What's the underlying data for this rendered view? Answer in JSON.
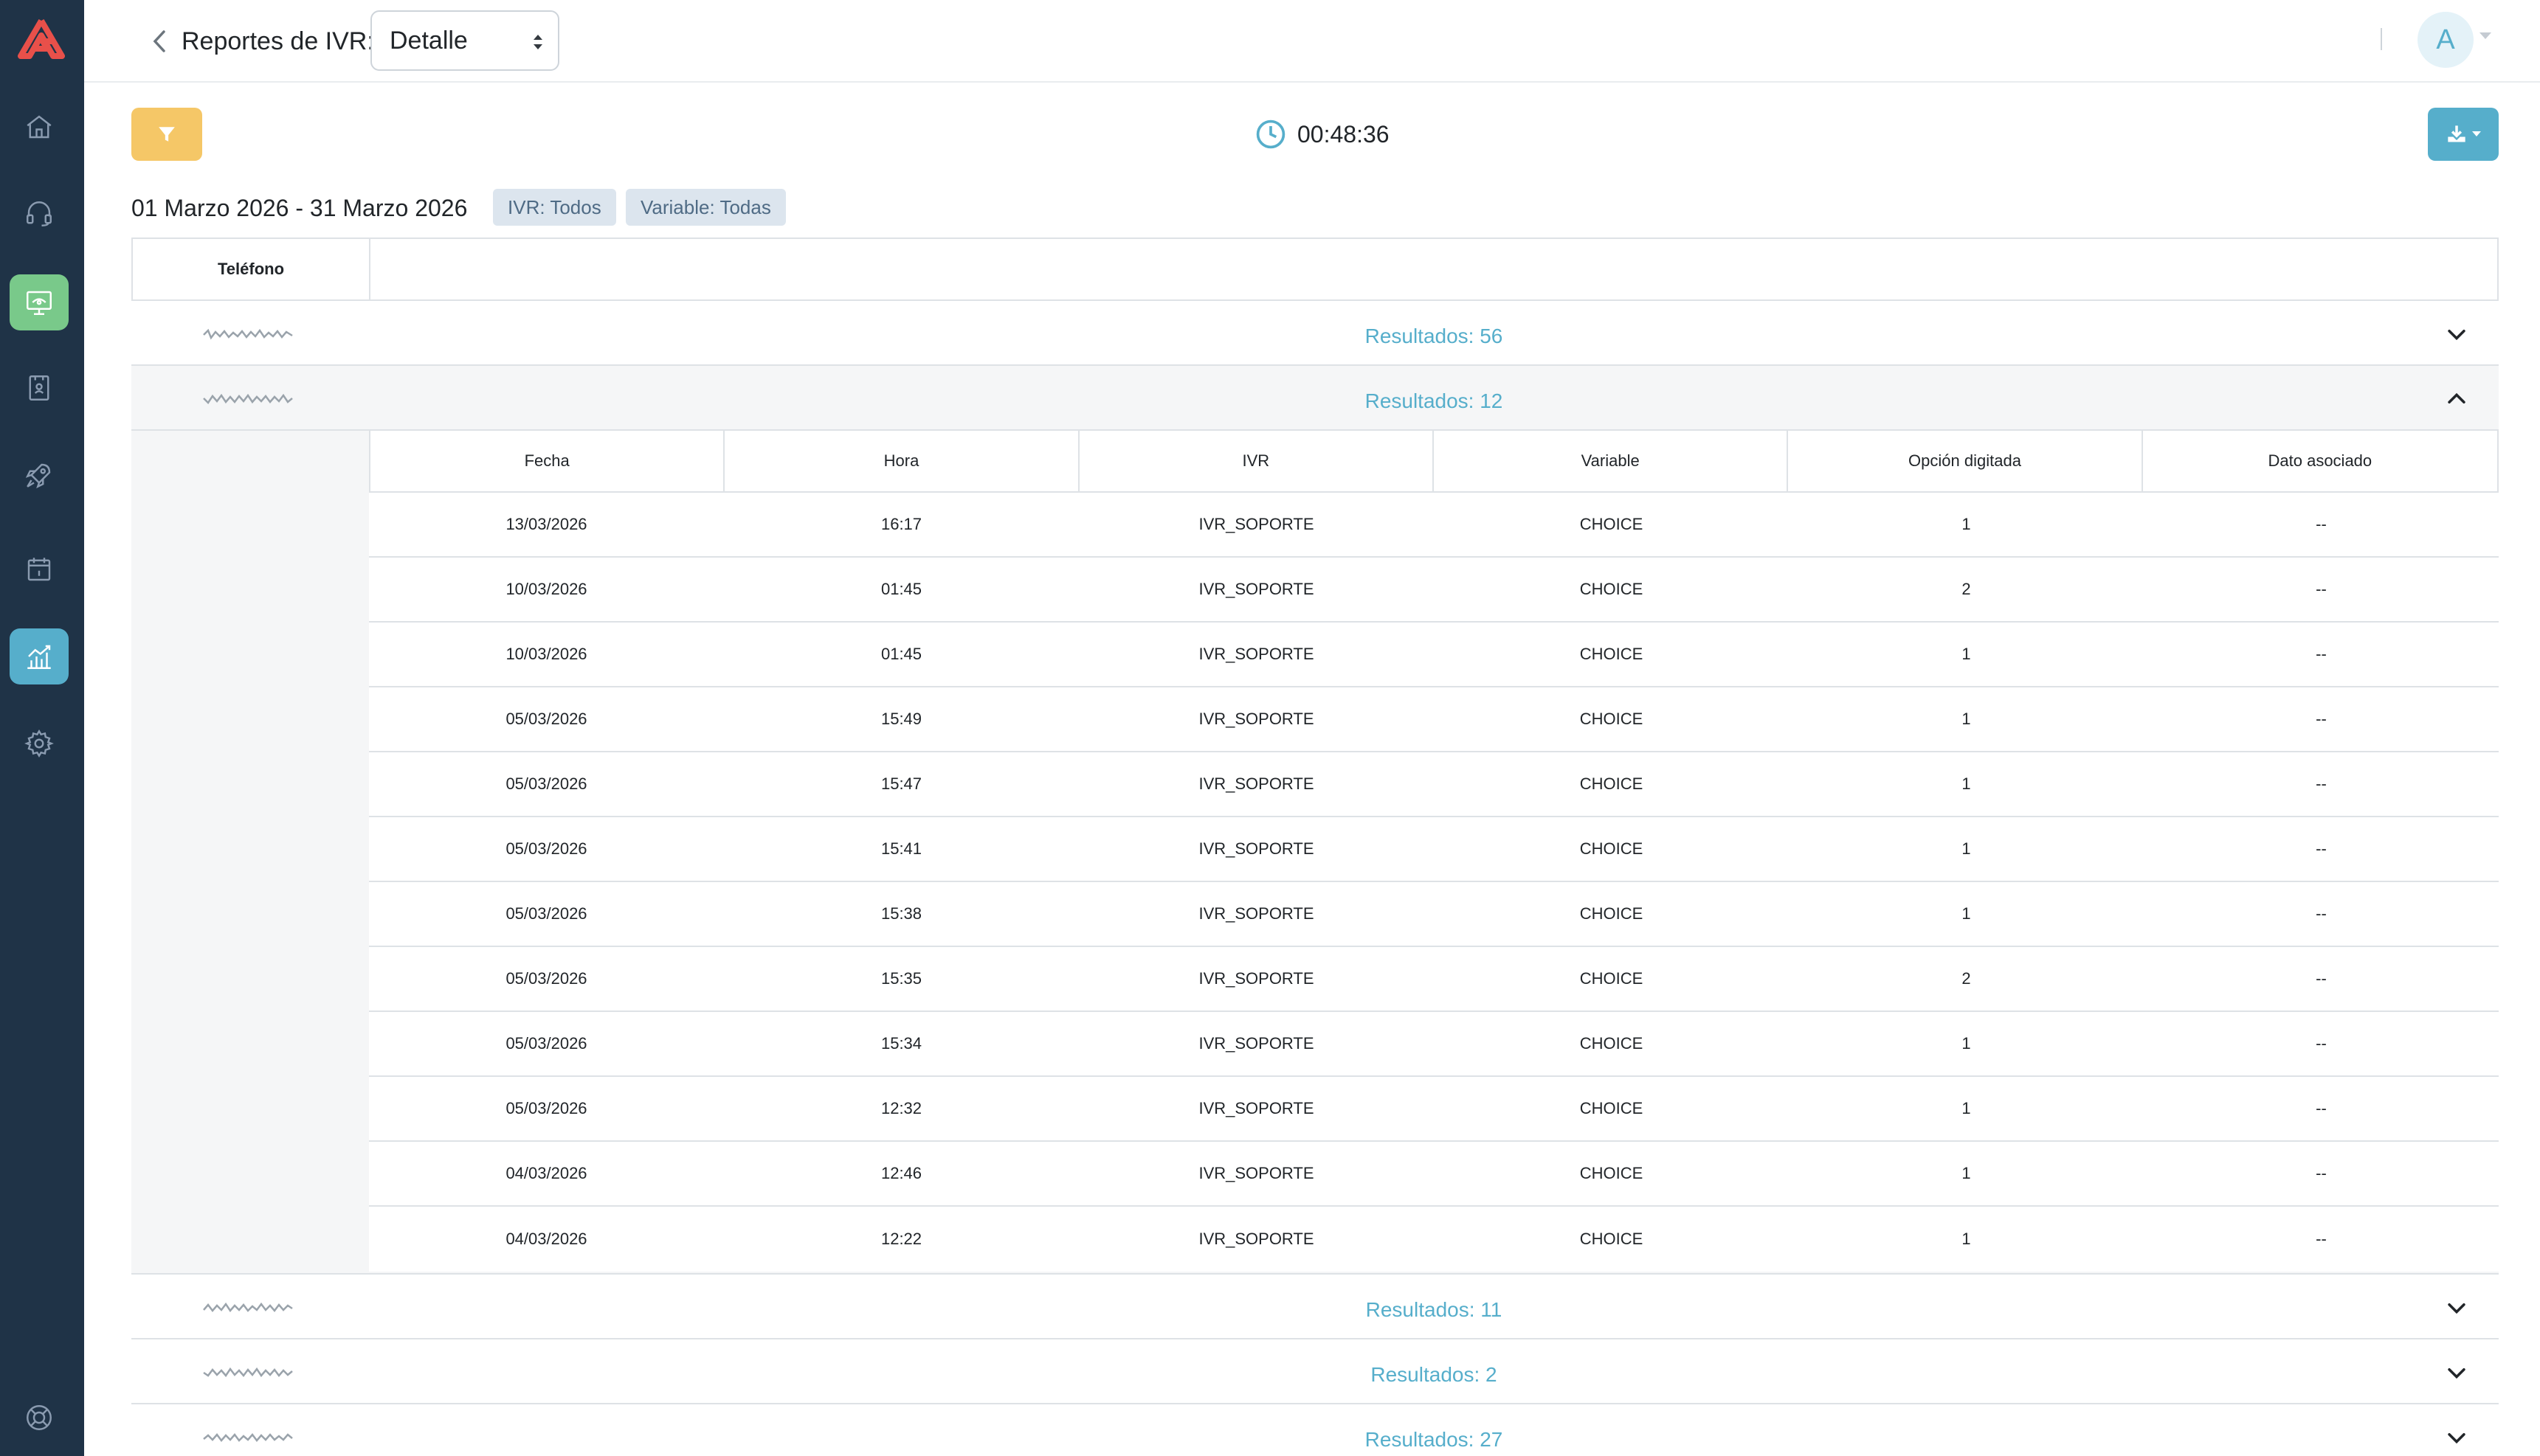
{
  "header": {
    "title": "Reportes de IVR:",
    "view_select": "Detalle",
    "avatar_initial": "A"
  },
  "toolbar": {
    "timer": "00:48:36"
  },
  "filters": {
    "date_range": "01 Marzo 2026 - 31 Marzo 2026",
    "chips": [
      "IVR: Todos",
      "Variable: Todas"
    ]
  },
  "table": {
    "phone_header": "Teléfono",
    "groups": [
      {
        "results": "Resultados: 56",
        "expanded": false
      },
      {
        "results": "Resultados: 12",
        "expanded": true
      },
      {
        "results": "Resultados: 11",
        "expanded": false
      },
      {
        "results": "Resultados: 2",
        "expanded": false
      },
      {
        "results": "Resultados: 27",
        "expanded": false
      }
    ],
    "detail_columns": [
      "Fecha",
      "Hora",
      "IVR",
      "Variable",
      "Opción digitada",
      "Dato asociado"
    ],
    "detail_rows": [
      [
        "13/03/2026",
        "16:17",
        "IVR_SOPORTE",
        "CHOICE",
        "1",
        "--"
      ],
      [
        "10/03/2026",
        "01:45",
        "IVR_SOPORTE",
        "CHOICE",
        "2",
        "--"
      ],
      [
        "10/03/2026",
        "01:45",
        "IVR_SOPORTE",
        "CHOICE",
        "1",
        "--"
      ],
      [
        "05/03/2026",
        "15:49",
        "IVR_SOPORTE",
        "CHOICE",
        "1",
        "--"
      ],
      [
        "05/03/2026",
        "15:47",
        "IVR_SOPORTE",
        "CHOICE",
        "1",
        "--"
      ],
      [
        "05/03/2026",
        "15:41",
        "IVR_SOPORTE",
        "CHOICE",
        "1",
        "--"
      ],
      [
        "05/03/2026",
        "15:38",
        "IVR_SOPORTE",
        "CHOICE",
        "1",
        "--"
      ],
      [
        "05/03/2026",
        "15:35",
        "IVR_SOPORTE",
        "CHOICE",
        "2",
        "--"
      ],
      [
        "05/03/2026",
        "15:34",
        "IVR_SOPORTE",
        "CHOICE",
        "1",
        "--"
      ],
      [
        "05/03/2026",
        "12:32",
        "IVR_SOPORTE",
        "CHOICE",
        "1",
        "--"
      ],
      [
        "04/03/2026",
        "12:46",
        "IVR_SOPORTE",
        "CHOICE",
        "1",
        "--"
      ],
      [
        "04/03/2026",
        "12:22",
        "IVR_SOPORTE",
        "CHOICE",
        "1",
        "--"
      ]
    ]
  },
  "sidebar": {
    "items": [
      {
        "icon": "home-icon"
      },
      {
        "icon": "headset-icon"
      },
      {
        "icon": "monitor-icon",
        "active": "green"
      },
      {
        "icon": "contacts-book-icon"
      },
      {
        "icon": "rocket-icon"
      },
      {
        "icon": "calendar-icon"
      },
      {
        "icon": "chart-icon",
        "active": "blue"
      },
      {
        "icon": "gear-icon"
      },
      {
        "icon": "help-lifebuoy-icon"
      }
    ]
  },
  "colors": {
    "sidebar_bg": "#1f3347",
    "accent_blue": "#56aecb",
    "accent_green": "#79c98a",
    "filter_yellow": "#f5c767",
    "logo_red": "#e8504a"
  }
}
